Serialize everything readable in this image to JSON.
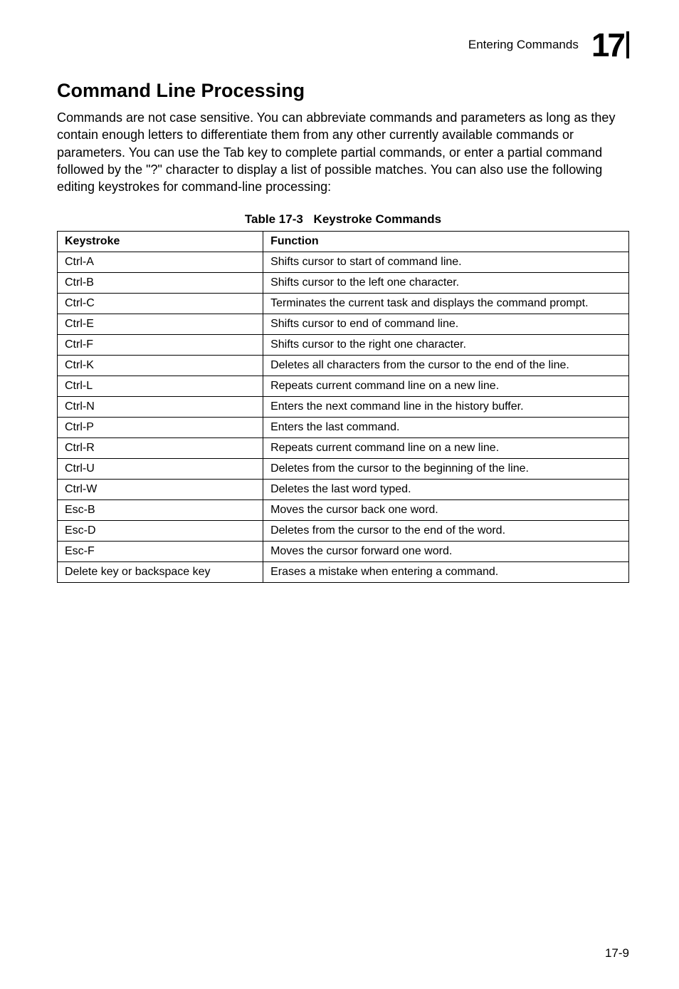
{
  "header": {
    "breadcrumb": "Entering Commands",
    "chapter_number": "17"
  },
  "section": {
    "title": "Command Line Processing",
    "intro": "Commands are not case sensitive. You can abbreviate commands and parameters as long as they contain enough letters to differentiate them from any other currently available commands or parameters. You can use the Tab key to complete partial commands, or enter a partial command followed by the \"?\" character to display a list of possible matches. You can also use the following editing keystrokes for command-line processing:"
  },
  "table": {
    "label": "Table 17-3",
    "title": "Keystroke Commands",
    "headers": {
      "keystroke": "Keystroke",
      "function": "Function"
    },
    "rows": [
      {
        "keystroke": "Ctrl-A",
        "function": "Shifts cursor to start of command line."
      },
      {
        "keystroke": "Ctrl-B",
        "function": "Shifts cursor to the left one character."
      },
      {
        "keystroke": "Ctrl-C",
        "function": "Terminates the current task and displays the command prompt."
      },
      {
        "keystroke": "Ctrl-E",
        "function": "Shifts cursor to end of command line."
      },
      {
        "keystroke": "Ctrl-F",
        "function": "Shifts cursor to the right one character."
      },
      {
        "keystroke": "Ctrl-K",
        "function": "Deletes all characters from the cursor to the end of the line."
      },
      {
        "keystroke": "Ctrl-L",
        "function": "Repeats current command line on a new line."
      },
      {
        "keystroke": "Ctrl-N",
        "function": "Enters the next command line in the history buffer."
      },
      {
        "keystroke": "Ctrl-P",
        "function": "Enters the last command."
      },
      {
        "keystroke": "Ctrl-R",
        "function": "Repeats current command line on a new line."
      },
      {
        "keystroke": "Ctrl-U",
        "function": "Deletes from the cursor to the beginning of the line."
      },
      {
        "keystroke": "Ctrl-W",
        "function": "Deletes the last word typed."
      },
      {
        "keystroke": "Esc-B",
        "function": "Moves the cursor back one word."
      },
      {
        "keystroke": "Esc-D",
        "function": "Deletes from the cursor to the end of the word."
      },
      {
        "keystroke": "Esc-F",
        "function": "Moves the cursor forward one word."
      },
      {
        "keystroke": "Delete key or backspace key",
        "function": "Erases a mistake when entering a command."
      }
    ]
  },
  "page_number": "17-9"
}
